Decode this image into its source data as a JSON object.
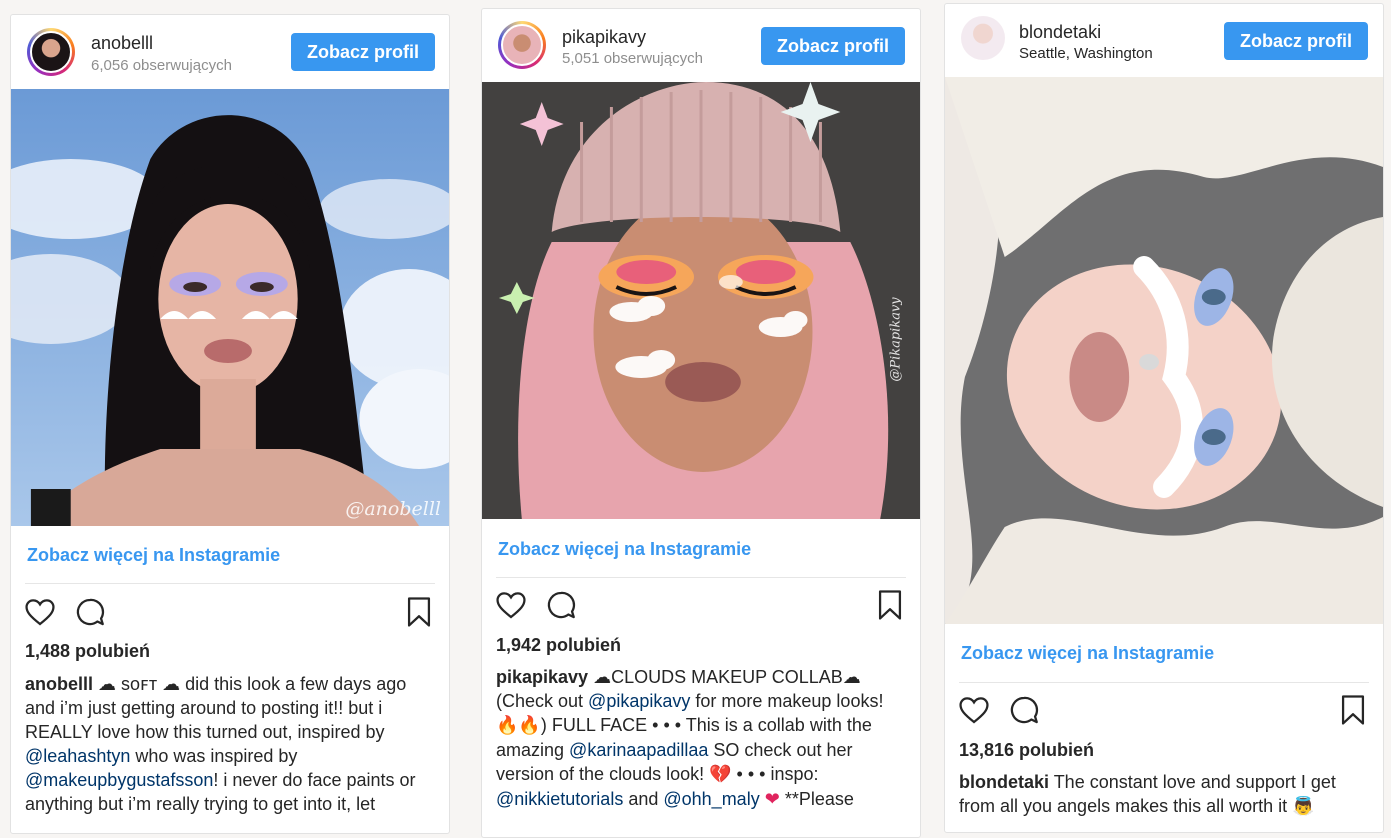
{
  "cards": [
    {
      "username": "anobelll",
      "subtitle": "6,056 obserwujących",
      "profile_button": "Zobacz profil",
      "watermark": "@anobelll",
      "more_link": "Zobacz więcej na Instagramie",
      "likes": "1,488 polubień",
      "caption": {
        "author": "anobelll",
        "p1": " ☁ sᴏꜰᴛ ☁ did this look a few days ago and i’m just getting around to posting it!! but i REALLY love how this turned out, inspired by ",
        "m1": "@leahashtyn",
        "p2": " who was inspired by ",
        "m2": "@makeupbygustafsson",
        "p3": "! i never do face paints or anything but i’m really trying to get into it, let"
      }
    },
    {
      "username": "pikapikavy",
      "subtitle": "5,051 obserwujących",
      "profile_button": "Zobacz profil",
      "watermark": "@Pikapikavy",
      "more_link": "Zobacz więcej na Instagramie",
      "likes": "1,942 polubień",
      "caption": {
        "author": "pikapikavy",
        "p1": " ☁CLOUDS MAKEUP COLLAB☁ (Check out ",
        "m1": "@pikapikavy",
        "p2": " for more makeup looks! ",
        "emoji1": "🔥🔥",
        "p3": ") FULL FACE • • • This is a collab with the amazing ",
        "m2": "@karinaapadillaa",
        "p4": " SO check out her version of the clouds look! ",
        "emoji2": "💔",
        "p5": " • • • inspo: ",
        "m3": "@nikkietutorials",
        "p6": " and ",
        "m4": "@ohh_maly",
        "emoji3": "❤",
        "p7": " **Please"
      }
    },
    {
      "username": "blondetaki",
      "subtitle": "Seattle, Washington",
      "profile_button": "Zobacz profil",
      "more_link": "Zobacz więcej na Instagramie",
      "likes": "13,816 polubień",
      "caption": {
        "author": "blondetaki",
        "p1": " The constant love and support I get from all you angels makes this all worth it ",
        "emoji1": "👼"
      }
    }
  ],
  "icons": [
    "heart-icon",
    "comment-icon",
    "bookmark-icon"
  ],
  "colors": {
    "link_blue": "#3897f0",
    "mention_blue": "#003569",
    "button_blue": "#3897f0"
  }
}
